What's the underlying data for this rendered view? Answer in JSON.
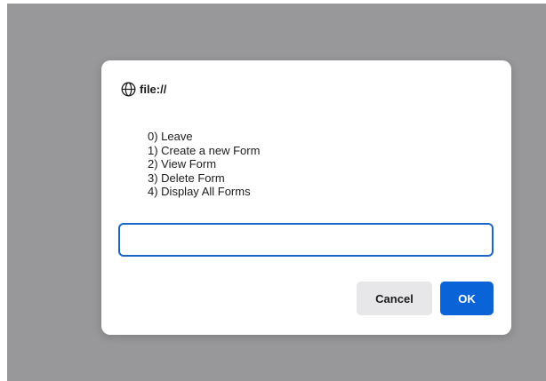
{
  "dialog": {
    "origin": "file://",
    "message_lines": [
      "0) Leave",
      "1) Create a new Form",
      "2) View Form",
      "3) Delete Form",
      "4) Display All Forms"
    ],
    "input_value": "",
    "cancel_label": "Cancel",
    "ok_label": "OK"
  },
  "icons": {
    "origin": "globe-icon"
  },
  "colors": {
    "backdrop": "#98989b",
    "dialog_bg": "#ffffff",
    "input_border": "#1a66c9",
    "ok_button": "#0a64d8",
    "cancel_button": "#e7e7ea"
  }
}
